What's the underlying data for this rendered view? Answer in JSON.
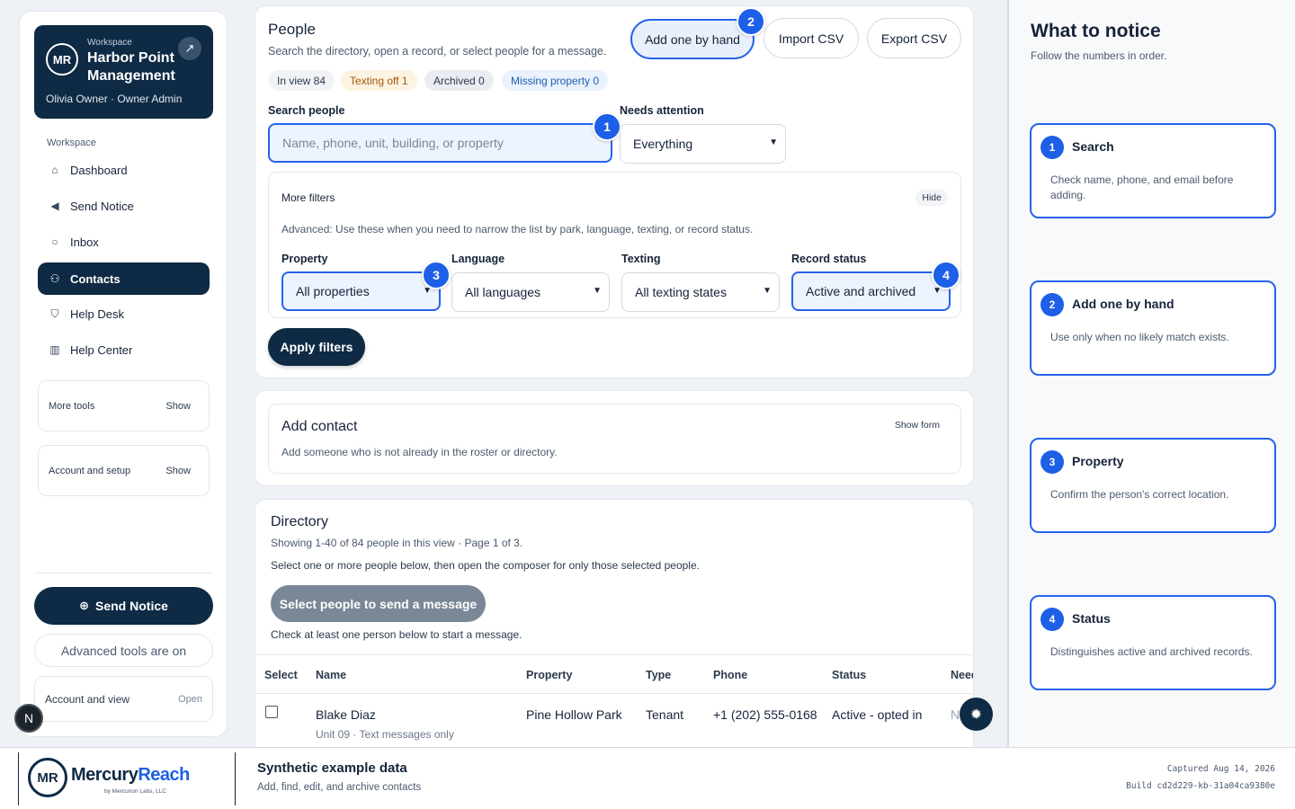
{
  "workspace": {
    "label": "Workspace",
    "name": "Harbor Point Management",
    "user": "Olivia Owner · Owner Admin",
    "logo_initials": "MR"
  },
  "nav": {
    "heading": "Workspace",
    "items": [
      {
        "label": "Dashboard",
        "icon": "home-icon"
      },
      {
        "label": "Send Notice",
        "icon": "megaphone-icon"
      },
      {
        "label": "Inbox",
        "icon": "chat-icon"
      },
      {
        "label": "Contacts",
        "icon": "users-icon"
      },
      {
        "label": "Help Desk",
        "icon": "shield-icon"
      },
      {
        "label": "Help Center",
        "icon": "book-icon"
      }
    ],
    "active": "Contacts"
  },
  "sidebar_boxes": {
    "more_tools": {
      "label": "More tools",
      "action": "Show"
    },
    "account_setup": {
      "label": "Account and setup",
      "action": "Show"
    }
  },
  "sidebar_bottom": {
    "send_notice": "Send Notice",
    "advanced": "Advanced tools are on",
    "account_view": "Account and view",
    "account_open": "Open",
    "n_badge": "N"
  },
  "people": {
    "title": "People",
    "subtitle": "Search the directory, open a record, or select people for a message.",
    "pills": [
      {
        "label": "In view 84",
        "bg": "#f1f3f6",
        "fg": "#2c3a4e"
      },
      {
        "label": "Texting off 1",
        "bg": "#fdf3e2",
        "fg": "#a2560c"
      },
      {
        "label": "Archived 0",
        "bg": "#e9ecf0",
        "fg": "#2c3a4e"
      },
      {
        "label": "Missing property 0",
        "bg": "#eaf2fd",
        "fg": "#1d5fb0"
      }
    ],
    "buttons": {
      "add": "Add one by hand",
      "import": "Import CSV",
      "export": "Export CSV"
    },
    "search": {
      "label": "Search people",
      "placeholder": "Name, phone, unit, building, or property"
    },
    "attention": {
      "label": "Needs attention",
      "value": "Everything"
    },
    "more_filters": {
      "title": "More filters",
      "hide": "Hide",
      "desc": "Advanced: Use these when you need to narrow the list by park, language, texting, or record status.",
      "property": {
        "label": "Property",
        "value": "All properties"
      },
      "language": {
        "label": "Language",
        "value": "All languages"
      },
      "texting": {
        "label": "Texting",
        "value": "All texting states"
      },
      "status": {
        "label": "Record status",
        "value": "Active and archived"
      }
    },
    "apply": "Apply filters"
  },
  "add_contact": {
    "title": "Add contact",
    "desc": "Add someone who is not already in the roster or directory.",
    "show_form": "Show form"
  },
  "directory": {
    "title": "Directory",
    "showing": "Showing 1-40 of 84 people in this view · Page 1 of 3.",
    "instructions": "Select one or more people below, then open the composer for only those selected people.",
    "select_btn": "Select people to send a message",
    "hint": "Check at least one person below to start a message.",
    "columns": [
      "Select",
      "Name",
      "Property",
      "Type",
      "Phone",
      "Status",
      "Need"
    ],
    "rows": [
      {
        "name": "Blake Diaz",
        "sub": "Unit 09 · Text messages only",
        "property": "Pine Hollow Park",
        "type": "Tenant",
        "phone": "+1 (202) 555-0168",
        "status": "Active - opted in",
        "need": "N"
      }
    ]
  },
  "notice": {
    "title": "What to notice",
    "subtitle": "Follow the numbers in order.",
    "steps": [
      {
        "n": "1",
        "title": "Search",
        "desc": "Check name, phone, and email before adding."
      },
      {
        "n": "2",
        "title": "Add one by hand",
        "desc": "Use only when no likely match exists."
      },
      {
        "n": "3",
        "title": "Property",
        "desc": "Confirm the person's correct location."
      },
      {
        "n": "4",
        "title": "Status",
        "desc": "Distinguishes active and archived records."
      }
    ]
  },
  "footer": {
    "brand_a": "Mercury",
    "brand_b": "Reach",
    "by": "by Mercurion Labs, LLC",
    "logo_initials": "MR",
    "title": "Synthetic example data",
    "subtitle": "Add, find, edit, and archive contacts",
    "captured": "Captured Aug 14, 2026",
    "build": "Build cd2d229-kb-31a04ca9380e"
  },
  "colors": {
    "navy": "#0f2a44",
    "accent": "#1d5fe6",
    "highlight_border": "#2563eb"
  }
}
